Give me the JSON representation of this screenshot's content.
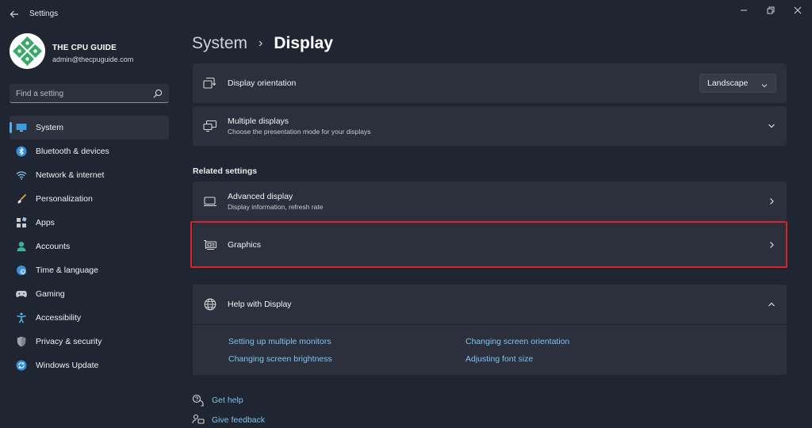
{
  "window": {
    "title": "Settings",
    "controls": [
      "minimize",
      "restore",
      "close"
    ]
  },
  "profile": {
    "name": "THE CPU GUIDE",
    "email": "admin@thecpuguide.com"
  },
  "search": {
    "placeholder": "Find a setting"
  },
  "nav": {
    "items": [
      {
        "label": "System",
        "icon": "monitor-icon",
        "active": true
      },
      {
        "label": "Bluetooth & devices",
        "icon": "bluetooth-icon"
      },
      {
        "label": "Network & internet",
        "icon": "wifi-icon"
      },
      {
        "label": "Personalization",
        "icon": "brush-icon"
      },
      {
        "label": "Apps",
        "icon": "apps-icon"
      },
      {
        "label": "Accounts",
        "icon": "person-icon"
      },
      {
        "label": "Time & language",
        "icon": "globe-clock-icon"
      },
      {
        "label": "Gaming",
        "icon": "gamepad-icon"
      },
      {
        "label": "Accessibility",
        "icon": "accessibility-icon"
      },
      {
        "label": "Privacy & security",
        "icon": "shield-icon"
      },
      {
        "label": "Windows Update",
        "icon": "sync-icon"
      }
    ]
  },
  "breadcrumb": {
    "parent": "System",
    "separator": "›",
    "current": "Display"
  },
  "settings": {
    "orientation": {
      "title": "Display orientation",
      "value": "Landscape"
    },
    "multiple": {
      "title": "Multiple displays",
      "subtitle": "Choose the presentation mode for your displays"
    }
  },
  "related": {
    "heading": "Related settings",
    "advanced": {
      "title": "Advanced display",
      "subtitle": "Display information, refresh rate"
    },
    "graphics": {
      "title": "Graphics"
    }
  },
  "help": {
    "title": "Help with Display",
    "links": [
      "Setting up multiple monitors",
      "Changing screen orientation",
      "Changing screen brightness",
      "Adjusting font size"
    ]
  },
  "footer": {
    "get_help": "Get help",
    "feedback": "Give feedback"
  },
  "colors": {
    "background": "#202532",
    "card": "#2b303c",
    "accent": "#4fb3e8",
    "link": "#7ec4ee",
    "highlight": "#d6252b"
  }
}
